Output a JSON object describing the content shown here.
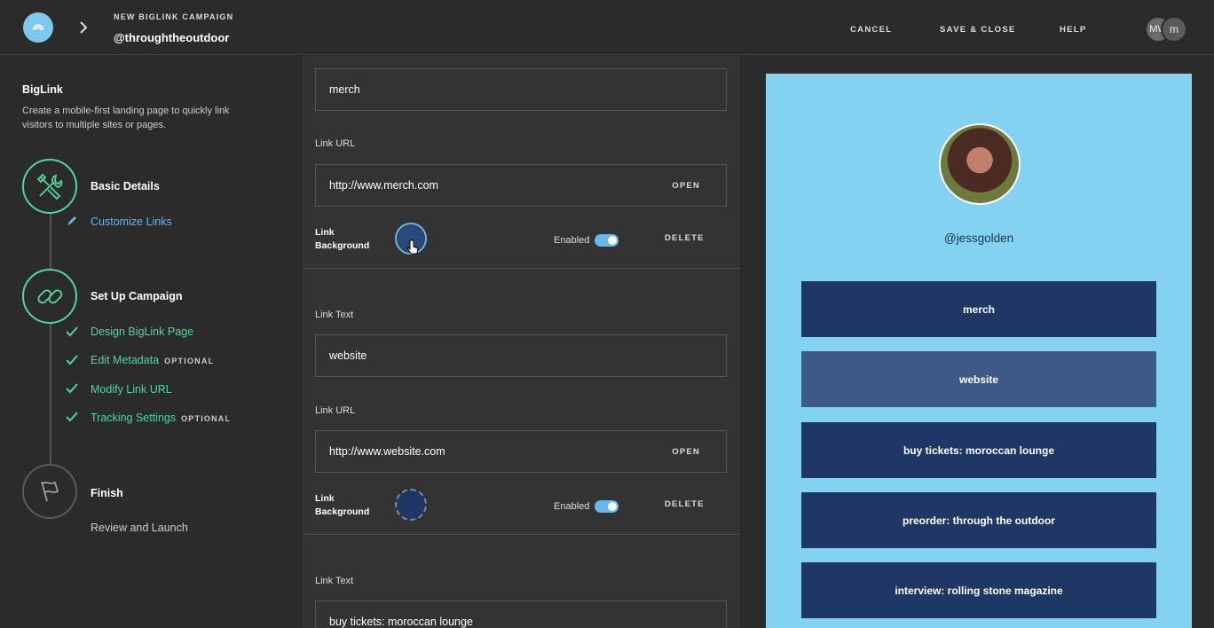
{
  "header": {
    "campaign_label": "NEW BIGLINK CAMPAIGN",
    "campaign_name": "@throughtheoutdoor",
    "cancel": "CANCEL",
    "save_close": "SAVE & CLOSE",
    "help": "HELP",
    "avatars": [
      "MW",
      "m"
    ]
  },
  "sidebar": {
    "title": "BigLink",
    "description": "Create a mobile-first landing page to quickly link visitors to multiple sites or pages.",
    "steps": [
      {
        "title": "Basic Details",
        "icon": "tools-icon",
        "subs": [
          {
            "label": "Customize Links",
            "state": "editing"
          }
        ]
      },
      {
        "title": "Set Up Campaign",
        "icon": "link-icon",
        "subs": [
          {
            "label": "Design BigLink Page",
            "state": "done",
            "optional": ""
          },
          {
            "label": "Edit Metadata",
            "state": "done",
            "optional": "OPTIONAL"
          },
          {
            "label": "Modify Link URL",
            "state": "done",
            "optional": ""
          },
          {
            "label": "Tracking Settings",
            "state": "done",
            "optional": "OPTIONAL"
          }
        ]
      },
      {
        "title": "Finish",
        "icon": "flag-icon",
        "subs": [
          {
            "label": "Review and Launch",
            "state": "pending"
          }
        ]
      }
    ]
  },
  "editor": {
    "link_text_label": "Link Text",
    "link_url_label": "Link URL",
    "link_bg_label_1": "Link",
    "link_bg_label_2": "Background",
    "enabled_label": "Enabled",
    "delete_label": "DELETE",
    "open_label": "OPEN",
    "links": [
      {
        "text": "merch",
        "url": "http://www.merch.com",
        "enabled": true,
        "color": "#2a4a7a"
      },
      {
        "text": "website",
        "url": "http://www.website.com",
        "enabled": true,
        "color": "#1f3764"
      },
      {
        "text": "buy tickets: moroccan lounge"
      }
    ]
  },
  "preview": {
    "handle": "@jessgolden",
    "background": "#84d2f1",
    "links": [
      "merch",
      "website",
      "buy tickets: moroccan lounge",
      "preorder: through the outdoor",
      "interview: rolling stone magazine"
    ]
  }
}
